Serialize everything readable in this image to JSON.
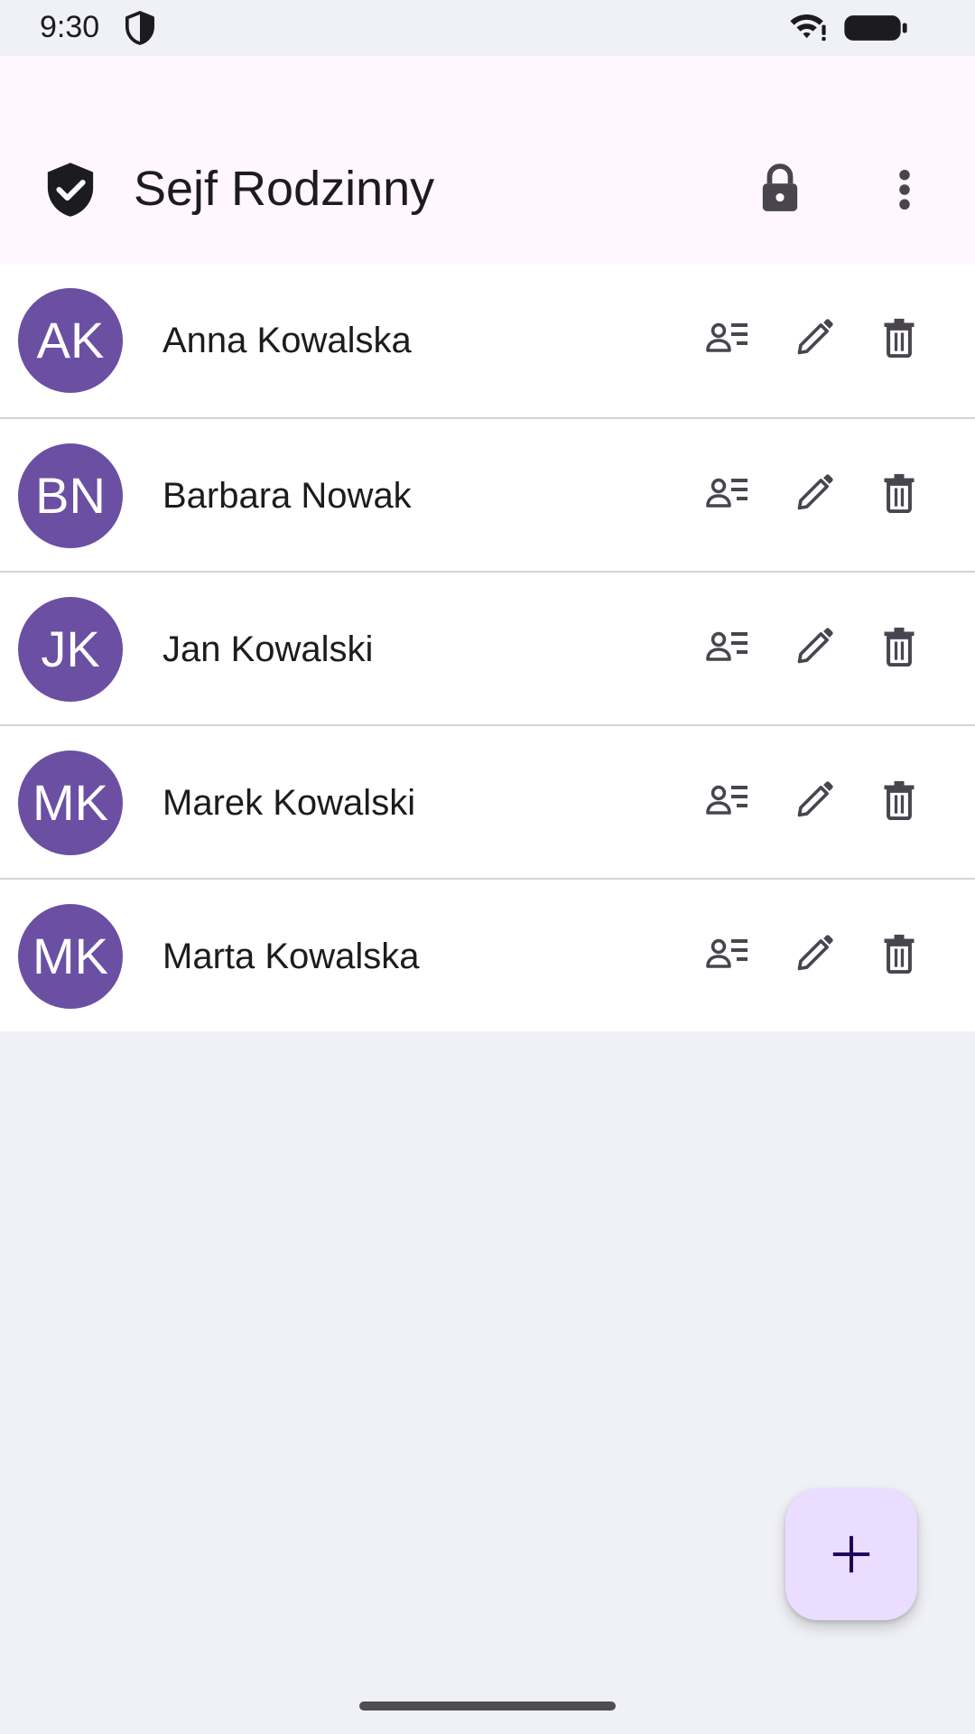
{
  "status_bar": {
    "time": "9:30",
    "icons": [
      "shield-icon",
      "wifi-icon",
      "battery-icon"
    ]
  },
  "app_bar": {
    "title": "Sejf Rodzinny",
    "logo_icon": "shield-check-icon",
    "actions": [
      "lock-icon",
      "more-vert-icon"
    ]
  },
  "contacts": [
    {
      "initials": "AK",
      "name": "Anna Kowalska"
    },
    {
      "initials": "BN",
      "name": "Barbara Nowak"
    },
    {
      "initials": "JK",
      "name": "Jan Kowalski"
    },
    {
      "initials": "MK",
      "name": "Marek Kowalski"
    },
    {
      "initials": "MK",
      "name": "Marta Kowalska"
    }
  ],
  "row_actions": [
    "contact-details-icon",
    "edit-icon",
    "delete-icon"
  ],
  "fab": {
    "icon": "add-icon"
  },
  "colors": {
    "avatar": "#6b4fa3",
    "app_bar": "#fff7fd",
    "background": "#f0f1f6",
    "fab": "#eaddff",
    "icon": "#49454f"
  }
}
